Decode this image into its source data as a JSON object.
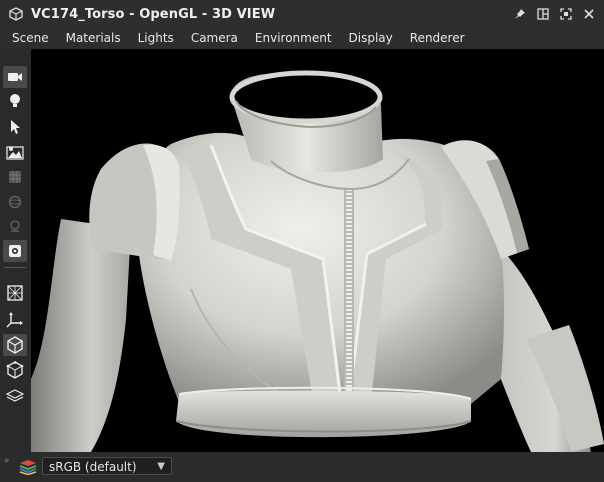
{
  "window": {
    "title": "VC174_Torso - OpenGL - 3D VIEW",
    "app_icon": "cube-app-icon",
    "controls": [
      "pin-icon",
      "layout-icon",
      "maximize-icon",
      "close-icon"
    ]
  },
  "menu": {
    "items": [
      "Scene",
      "Materials",
      "Lights",
      "Camera",
      "Environment",
      "Display",
      "Renderer"
    ]
  },
  "toolbar": {
    "icons": [
      "camera-icon",
      "light-bulb-icon",
      "select-arrow-icon",
      "environment-image-icon",
      "texture-icon",
      "sphere-icon",
      "light-probe-icon",
      "settings-icon",
      "wireframe-cube-icon",
      "axis-gizmo-icon",
      "solid-cube-icon",
      "bounding-box-icon",
      "layers-icon"
    ]
  },
  "colorspace": {
    "selected": "sRGB (default)",
    "icon": "layers-stack-icon"
  },
  "colors": {
    "accent_red": "#e04a3a",
    "accent_green": "#4caf50",
    "accent_blue": "#3a7bd5",
    "accent_yellow": "#f2c230",
    "model_base": "#d8d6d1"
  }
}
